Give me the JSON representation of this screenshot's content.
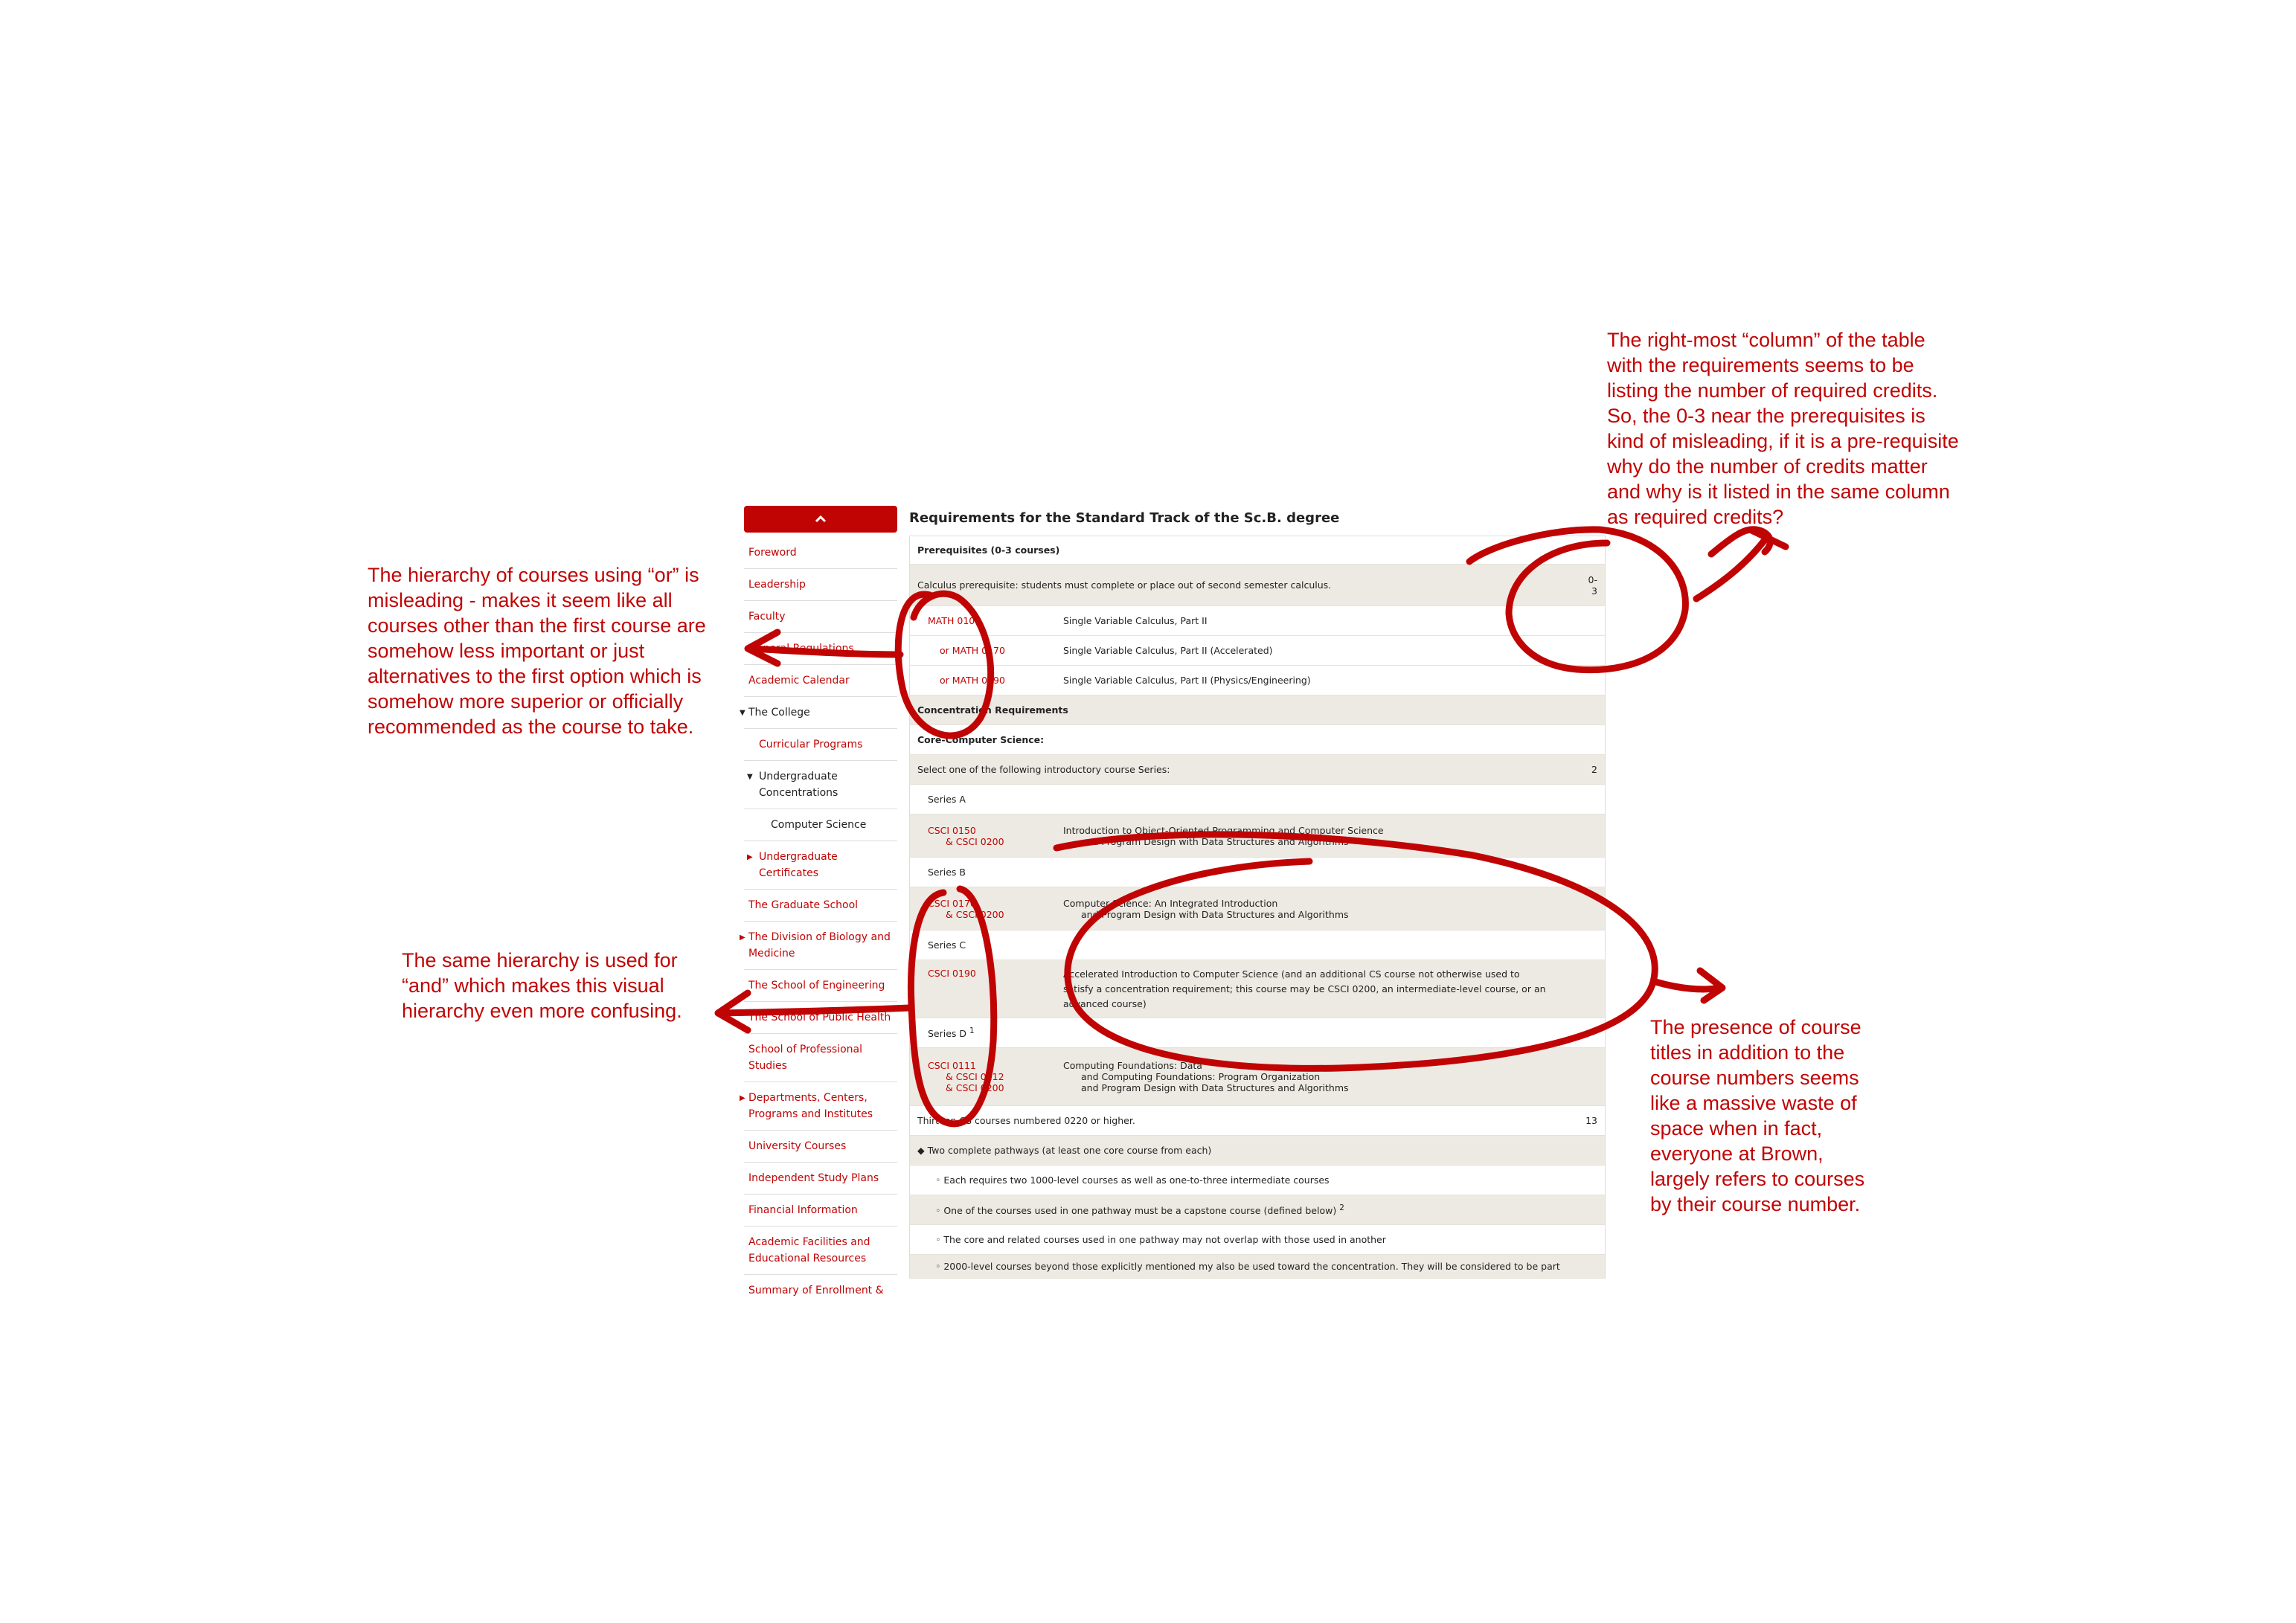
{
  "sidebar": {
    "items": [
      {
        "label": "Foreword"
      },
      {
        "label": "Leadership"
      },
      {
        "label": "Faculty"
      },
      {
        "label": "General Regulations"
      },
      {
        "label": "Academic Calendar"
      },
      {
        "label": "The College"
      },
      {
        "label": "Curricular Programs"
      },
      {
        "label": "Undergraduate Concentrations"
      },
      {
        "label": "Computer Science"
      },
      {
        "label": "Undergraduate Certificates"
      },
      {
        "label": "The Graduate School"
      },
      {
        "label": "The Division of Biology and Medicine"
      },
      {
        "label": "The School of Engineering"
      },
      {
        "label": "The School of Public Health"
      },
      {
        "label": "School of Professional Studies"
      },
      {
        "label": "Departments, Centers, Programs and Institutes"
      },
      {
        "label": "University Courses"
      },
      {
        "label": "Independent Study Plans"
      },
      {
        "label": "Financial Information"
      },
      {
        "label": "Academic Facilities and Educational Resources"
      },
      {
        "label": "Summary of Enrollment &"
      }
    ]
  },
  "main": {
    "heading": "Requirements for the Standard Track of the Sc.B. degree",
    "prereq_header": "Prerequisites (0-3 courses)",
    "calc_text": "Calculus prerequisite: students must complete or place out of second semester calculus.",
    "calc_hours_a": "0-",
    "calc_hours_b": "3",
    "math_rows": [
      {
        "code": "MATH 0100",
        "title": "Single Variable Calculus, Part II"
      },
      {
        "code": "or MATH 0170",
        "title": "Single Variable Calculus, Part II (Accelerated)"
      },
      {
        "code": "or MATH 0190",
        "title": "Single Variable Calculus, Part II (Physics/Engineering)"
      }
    ],
    "conc_header": "Concentration Requirements",
    "core_header": "Core-Computer Science:",
    "select_text": "Select one of the following introductory course Series:",
    "select_hours": "2",
    "series_a": "Series A",
    "series_a_code1": "CSCI 0150",
    "series_a_code2": "& CSCI 0200",
    "series_a_title1": "Introduction to Object-Oriented Programming and Computer Science",
    "series_a_title2": "and Program Design with Data Structures and Algorithms",
    "series_b": "Series B",
    "series_b_code1": "CSCI 0170",
    "series_b_code2": "& CSCI 0200",
    "series_b_title1": "Computer Science: An Integrated Introduction",
    "series_b_title2": "and Program Design with Data Structures and Algorithms",
    "series_c": "Series C",
    "series_c_code": "CSCI 0190",
    "series_c_title": "Accelerated Introduction to Computer Science (and an additional CS course not otherwise used to satisfy a concentration requirement; this course may be CSCI 0200, an intermediate-level course, or an advanced course)",
    "series_d": "Series D",
    "series_d_sup": "1",
    "series_d_code1": "CSCI 0111",
    "series_d_code2": "& CSCI 0112",
    "series_d_code3": "& CSCI 0200",
    "series_d_title1": "Computing Foundations: Data",
    "series_d_title2": "and Computing Foundations: Program Organization",
    "series_d_title3": "and Program Design with Data Structures and Algorithms",
    "thirteen_text": "Thirteen CS courses numbered 0220 or higher.",
    "thirteen_hours": "13",
    "pathways_text": "◆ Two complete pathways (at least one core course from each)",
    "bullets": [
      "◦ Each requires two 1000-level courses as well as one-to-three intermediate courses",
      "◦ One of the courses used in one pathway must be a capstone course (defined below)",
      "◦ The core and related courses used in one pathway may not overlap with those used in another",
      "◦ 2000-level courses beyond those explicitly mentioned my also be used toward the concentration. They will be considered to be part"
    ],
    "bullet2_sup": "2"
  },
  "annotations": {
    "right_top": "The right-most “column” of the table\nwith the requirements seems to be\nlisting the number of required credits.\nSo, the 0-3 near the prerequisites is\nkind of misleading, if it is a pre-requisite\nwhy do the number of credits matter\nand why is it listed in the same column\nas required credits?",
    "left_top": "The hierarchy of courses using “or” is\nmisleading - makes it seem like all\ncourses other than the first course are\nsomehow less important or just\nalternatives to the first option which is\nsomehow more superior or officially\nrecommended as the course to take.",
    "left_bottom": "The same hierarchy is used for\n“and” which makes this visual\nhierarchy even more confusing.",
    "right_bottom": "The presence of course\ntitles in addition to the\ncourse numbers seems\nlike a massive waste of\nspace when in fact,\neveryone at Brown,\nlargely refers to courses\nby their course number.",
    "ink_color": "#c00404"
  }
}
